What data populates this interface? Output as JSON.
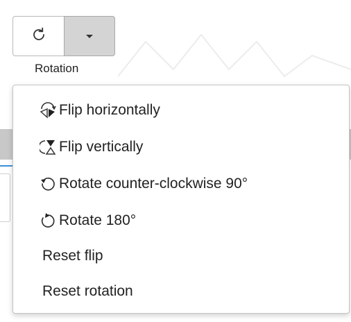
{
  "toolbar": {
    "rotation_label": "Rotation",
    "rotate_button_icon": "rotate-clockwise-icon",
    "dropdown_icon": "caret-down-icon"
  },
  "menu": {
    "items": [
      {
        "label": "Flip horizontally",
        "icon": "flip-horizontal-icon"
      },
      {
        "label": "Flip vertically",
        "icon": "flip-vertical-icon"
      },
      {
        "label": "Rotate counter-clockwise 90°",
        "icon": "rotate-ccw-icon"
      },
      {
        "label": "Rotate 180°",
        "icon": "rotate-180-icon"
      },
      {
        "label": "Reset flip",
        "icon": ""
      },
      {
        "label": "Reset rotation",
        "icon": ""
      }
    ]
  },
  "colors": {
    "dropdown_pressed_bg": "#d4d4d4",
    "border": "#b9b9b9",
    "accent_line": "#3b8fd9"
  }
}
